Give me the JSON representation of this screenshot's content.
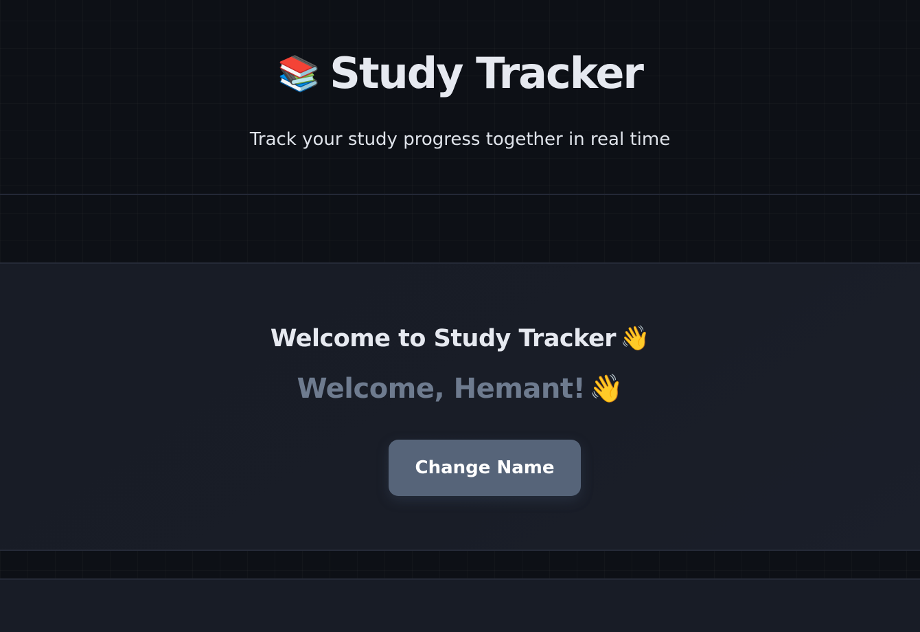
{
  "header": {
    "icon": "books-icon",
    "icon_glyph": "📚",
    "title": "Study Tracker",
    "subtitle": "Track your study progress together in real time"
  },
  "welcome_card": {
    "heading": "Welcome to Study Tracker",
    "heading_emoji": "👋",
    "greeting": "Welcome, Hemant!",
    "greeting_emoji": "👋",
    "change_name_label": "Change Name"
  },
  "colors": {
    "background": "#0d1016",
    "card": "#181c26",
    "button": "#566479",
    "greeting_text": "#6e7b8f"
  }
}
